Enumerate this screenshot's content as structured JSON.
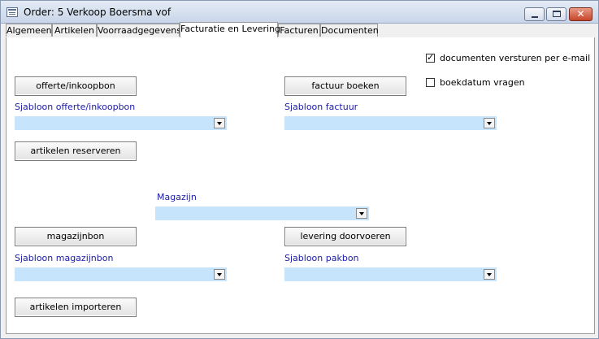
{
  "window": {
    "title": "Order: 5 Verkoop Boersma vof"
  },
  "tabs": [
    {
      "label": "Algemeen"
    },
    {
      "label": "Artikelen"
    },
    {
      "label": "Voorraadgegevens"
    },
    {
      "label": "Facturatie en Levering"
    },
    {
      "label": "Facturen"
    },
    {
      "label": "Documenten"
    }
  ],
  "active_tab": "Facturatie en Levering",
  "options": {
    "send_email_label": "documenten versturen per e-mail",
    "send_email_checked": true,
    "ask_date_label": "boekdatum vragen",
    "ask_date_checked": false
  },
  "buttons": {
    "offerte": "offerte/inkoopbon",
    "factuur": "factuur boeken",
    "reserveren": "artikelen reserveren",
    "magazijnbon": "magazijnbon",
    "levering": "levering doorvoeren",
    "importeren": "artikelen importeren"
  },
  "fields": {
    "sjabloon_offerte": {
      "label": "Sjabloon offerte/inkoopbon",
      "value": ""
    },
    "sjabloon_factuur": {
      "label": "Sjabloon factuur",
      "value": ""
    },
    "magazijn": {
      "label": "Magazijn",
      "value": ""
    },
    "sjabloon_magazijnbon": {
      "label": "Sjabloon magazijnbon",
      "value": ""
    },
    "sjabloon_pakbon": {
      "label": "Sjabloon pakbon",
      "value": ""
    }
  },
  "colors": {
    "field_bg": "#c6e4fb",
    "label_text": "#1a1aa8",
    "titlebar": "#c9d6e9"
  }
}
